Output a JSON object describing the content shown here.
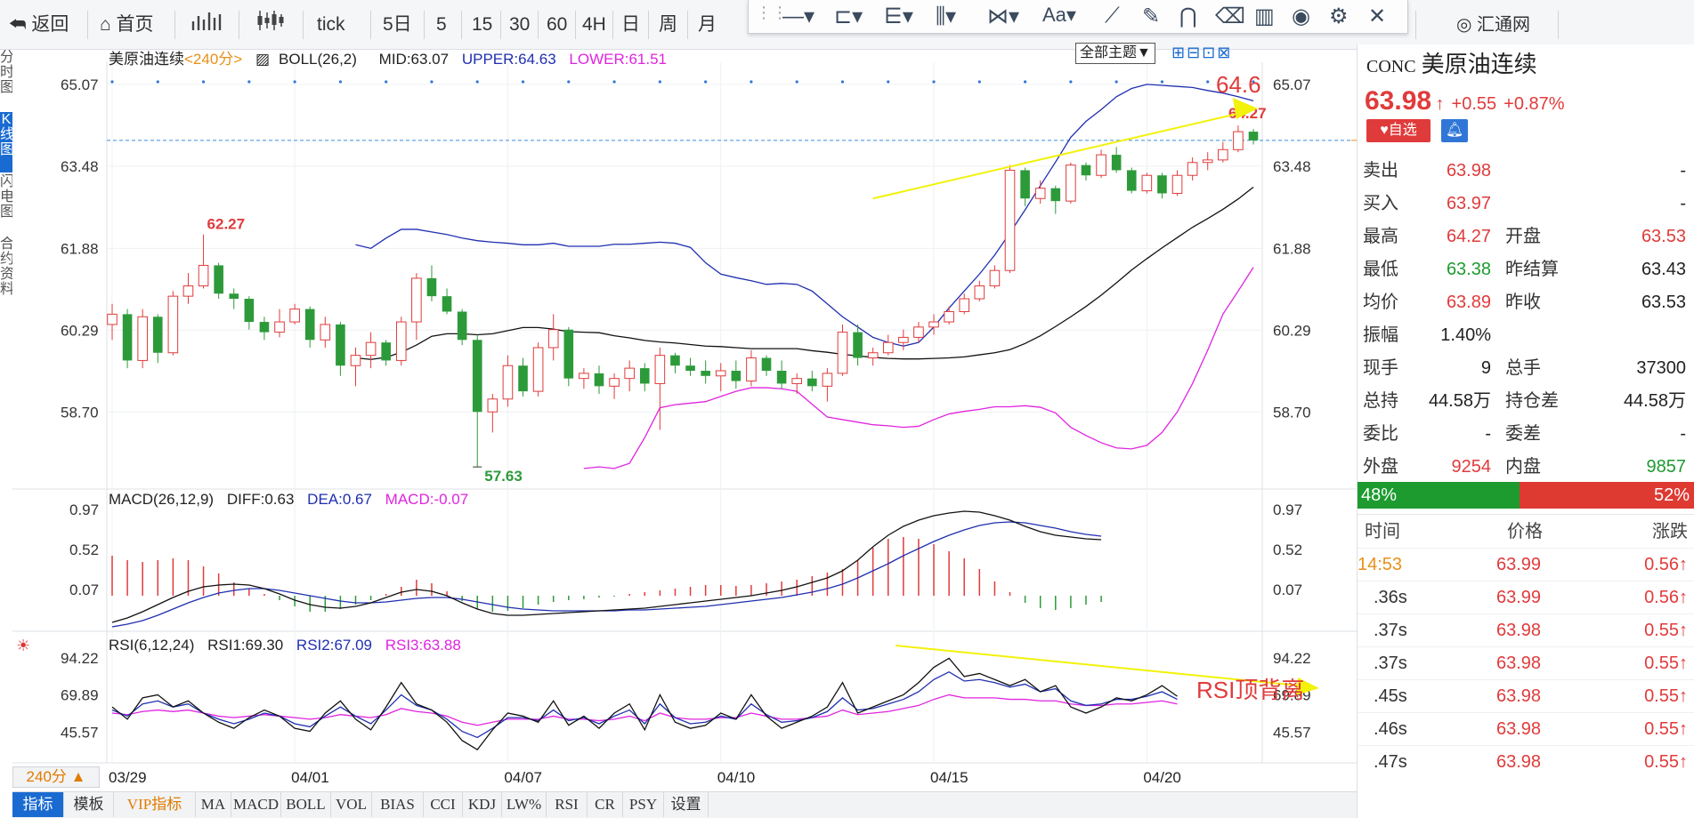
{
  "toolbar": {
    "back": "返回",
    "home": "首页",
    "tick": "tick",
    "five_day": "5日",
    "p5": "5",
    "p15": "15",
    "p30": "30",
    "p60": "60",
    "p4h": "4H",
    "day": "日",
    "week": "周",
    "month": "月",
    "brand": "汇通网"
  },
  "left_tabs": [
    "分时图",
    "K线图",
    "闪电图",
    "合约资料"
  ],
  "main_legend": {
    "name": "美原油连续",
    "period": "<240分>",
    "boll": "BOLL(26,2)",
    "mid": "MID:63.07",
    "upper": "UPPER:64.63",
    "lower": "LOWER:61.51"
  },
  "theme_button": "全部主题▼",
  "macd_legend": {
    "name": "MACD(26,12,9)",
    "diff": "DIFF:0.63",
    "dea": "DEA:0.67",
    "macd": "MACD:-0.07"
  },
  "rsi_legend": {
    "name": "RSI(6,12,24)",
    "rsi1": "RSI1:69.30",
    "rsi2": "RSI2:67.09",
    "rsi3": "RSI3:63.88"
  },
  "annotations": {
    "high_label": "62.27",
    "low_label": "57.63",
    "last_high": "64.27",
    "arrow_target": "64.6",
    "rsi_divergence": "RSI顶背离"
  },
  "period_button": "240分 ▲",
  "bottom_tabs": [
    "指标",
    "模板",
    "VIP指标",
    "MA",
    "MACD",
    "BOLL",
    "VOL",
    "BIAS",
    "CCI",
    "KDJ",
    "LW%",
    "RSI",
    "CR",
    "PSY",
    "设置"
  ],
  "quote": {
    "code": "CONC",
    "name": "美原油连续",
    "price": "63.98",
    "change": "+0.55",
    "change_pct": "+0.87%",
    "fav": "自选",
    "rows": [
      {
        "l1": "卖出",
        "v1": "63.98",
        "l2": "",
        "v2": "-",
        "c1": "red",
        "c2": "black"
      },
      {
        "l1": "买入",
        "v1": "63.97",
        "l2": "",
        "v2": "-",
        "c1": "red",
        "c2": "black"
      },
      {
        "l1": "最高",
        "v1": "64.27",
        "l2": "开盘",
        "v2": "63.53",
        "c1": "red",
        "c2": "red"
      },
      {
        "l1": "最低",
        "v1": "63.38",
        "l2": "昨结算",
        "v2": "63.43",
        "c1": "green",
        "c2": "black"
      },
      {
        "l1": "均价",
        "v1": "63.89",
        "l2": "昨收",
        "v2": "63.53",
        "c1": "red",
        "c2": "black"
      },
      {
        "l1": "振幅",
        "v1": "1.40%",
        "l2": "",
        "v2": "",
        "c1": "black",
        "c2": "black"
      },
      {
        "l1": "现手",
        "v1": "9",
        "l2": "总手",
        "v2": "37300",
        "c1": "black",
        "c2": "black"
      },
      {
        "l1": "总持",
        "v1": "44.58万",
        "l2": "持仓差",
        "v2": "44.58万",
        "c1": "black",
        "c2": "black"
      },
      {
        "l1": "委比",
        "v1": "-",
        "l2": "委差",
        "v2": "-",
        "c1": "black",
        "c2": "black"
      },
      {
        "l1": "外盘",
        "v1": "9254",
        "l2": "内盘",
        "v2": "9857",
        "c1": "red",
        "c2": "green"
      }
    ],
    "ratio_green": "48%",
    "ratio_red": "52%",
    "ratio_green_value": 0.48,
    "tick_header": {
      "time": "时间",
      "price": "价格",
      "change": "涨跌"
    },
    "ticks": [
      {
        "time": "14:53",
        "price": "63.99",
        "change": "0.56"
      },
      {
        "time": ".36s",
        "price": "63.99",
        "change": "0.56"
      },
      {
        "time": ".37s",
        "price": "63.98",
        "change": "0.55"
      },
      {
        "time": ".37s",
        "price": "63.98",
        "change": "0.55"
      },
      {
        "time": ".45s",
        "price": "63.98",
        "change": "0.55"
      },
      {
        "time": ".46s",
        "price": "63.98",
        "change": "0.55"
      },
      {
        "time": ".47s",
        "price": "63.98",
        "change": "0.55"
      }
    ]
  },
  "colors": {
    "up": "#e03b3b",
    "down": "#2d9a3a",
    "upper_band": "#1f2fb0",
    "mid_band": "#111111",
    "lower_band": "#e024e0",
    "annotation": "#f2f20a",
    "accent": "#1a6bd1"
  },
  "chart_data": {
    "type": "candlestick",
    "main_axis_ticks": [
      "65.07",
      "63.48",
      "61.88",
      "60.29",
      "58.70"
    ],
    "main_axis_values": [
      65.07,
      63.48,
      61.88,
      60.29,
      58.7
    ],
    "macd_axis_ticks": [
      "0.97",
      "0.52",
      "0.07"
    ],
    "macd_axis_values": [
      0.97,
      0.52,
      0.07
    ],
    "rsi_axis_ticks": [
      "94.22",
      "69.89",
      "45.57"
    ],
    "rsi_axis_values": [
      94.22,
      69.89,
      45.57
    ],
    "x_labels": [
      "03/29",
      "04/01",
      "04/07",
      "04/10",
      "04/15",
      "04/20"
    ],
    "x_label_index": [
      0,
      12,
      26,
      40,
      54,
      68
    ],
    "candles": [
      [
        60.4,
        60.8,
        60.1,
        60.6
      ],
      [
        60.6,
        60.7,
        59.55,
        59.7
      ],
      [
        59.7,
        60.7,
        59.55,
        60.55
      ],
      [
        60.55,
        60.6,
        59.65,
        59.85
      ],
      [
        59.85,
        61.05,
        59.8,
        60.95
      ],
      [
        60.95,
        61.4,
        60.8,
        61.15
      ],
      [
        61.15,
        62.15,
        61.1,
        61.55
      ],
      [
        61.55,
        61.6,
        60.9,
        61.0
      ],
      [
        61.0,
        61.1,
        60.7,
        60.9
      ],
      [
        60.9,
        60.95,
        60.3,
        60.45
      ],
      [
        60.45,
        60.55,
        60.1,
        60.25
      ],
      [
        60.25,
        60.7,
        60.15,
        60.45
      ],
      [
        60.45,
        60.8,
        60.4,
        60.7
      ],
      [
        60.7,
        60.75,
        59.95,
        60.1
      ],
      [
        60.1,
        60.55,
        59.95,
        60.4
      ],
      [
        60.4,
        60.45,
        59.4,
        59.6
      ],
      [
        59.6,
        59.95,
        59.2,
        59.8
      ],
      [
        59.8,
        60.25,
        59.55,
        60.05
      ],
      [
        60.05,
        60.1,
        59.6,
        59.7
      ],
      [
        59.7,
        60.55,
        59.6,
        60.45
      ],
      [
        60.45,
        61.4,
        60.1,
        61.3
      ],
      [
        61.3,
        61.55,
        60.85,
        60.95
      ],
      [
        60.95,
        61.1,
        60.6,
        60.65
      ],
      [
        60.65,
        60.7,
        60.0,
        60.1
      ],
      [
        60.1,
        60.2,
        57.63,
        58.7
      ],
      [
        58.7,
        59.05,
        58.3,
        58.95
      ],
      [
        58.95,
        59.8,
        58.8,
        59.6
      ],
      [
        59.6,
        59.75,
        59.0,
        59.1
      ],
      [
        59.1,
        60.05,
        59.0,
        59.95
      ],
      [
        59.95,
        60.6,
        59.7,
        60.3
      ],
      [
        60.3,
        60.35,
        59.2,
        59.35
      ],
      [
        59.35,
        59.55,
        59.15,
        59.45
      ],
      [
        59.45,
        59.6,
        59.05,
        59.2
      ],
      [
        59.2,
        59.45,
        58.95,
        59.35
      ],
      [
        59.35,
        59.7,
        59.1,
        59.55
      ],
      [
        59.55,
        59.65,
        59.1,
        59.25
      ],
      [
        59.25,
        59.95,
        58.35,
        59.8
      ],
      [
        59.8,
        59.85,
        59.45,
        59.6
      ],
      [
        59.6,
        59.75,
        59.4,
        59.5
      ],
      [
        59.5,
        59.7,
        59.25,
        59.4
      ],
      [
        59.4,
        59.65,
        59.1,
        59.5
      ],
      [
        59.5,
        59.7,
        59.15,
        59.3
      ],
      [
        59.3,
        59.9,
        59.2,
        59.75
      ],
      [
        59.75,
        59.8,
        59.4,
        59.5
      ],
      [
        59.5,
        59.7,
        59.15,
        59.25
      ],
      [
        59.25,
        59.45,
        59.05,
        59.35
      ],
      [
        59.35,
        59.5,
        59.1,
        59.2
      ],
      [
        59.2,
        59.55,
        58.9,
        59.45
      ],
      [
        59.45,
        60.4,
        59.4,
        60.25
      ],
      [
        60.25,
        60.4,
        59.6,
        59.75
      ],
      [
        59.75,
        59.95,
        59.6,
        59.85
      ],
      [
        59.85,
        60.2,
        59.8,
        60.05
      ],
      [
        60.05,
        60.3,
        59.9,
        60.15
      ],
      [
        60.15,
        60.45,
        60.05,
        60.35
      ],
      [
        60.35,
        60.6,
        60.2,
        60.45
      ],
      [
        60.45,
        60.75,
        60.4,
        60.65
      ],
      [
        60.65,
        61.0,
        60.6,
        60.9
      ],
      [
        60.9,
        61.25,
        60.85,
        61.15
      ],
      [
        61.15,
        61.55,
        61.1,
        61.45
      ],
      [
        61.45,
        63.5,
        61.4,
        63.4
      ],
      [
        63.4,
        63.45,
        62.7,
        62.85
      ],
      [
        62.85,
        63.2,
        62.75,
        63.05
      ],
      [
        63.05,
        63.1,
        62.55,
        62.8
      ],
      [
        62.8,
        63.55,
        62.75,
        63.5
      ],
      [
        63.5,
        63.55,
        63.2,
        63.3
      ],
      [
        63.3,
        63.8,
        63.25,
        63.7
      ],
      [
        63.7,
        63.85,
        63.35,
        63.4
      ],
      [
        63.4,
        63.45,
        62.95,
        63.0
      ],
      [
        63.0,
        63.35,
        62.95,
        63.3
      ],
      [
        63.3,
        63.35,
        62.85,
        62.95
      ],
      [
        62.95,
        63.4,
        62.9,
        63.3
      ],
      [
        63.3,
        63.65,
        63.2,
        63.55
      ],
      [
        63.55,
        63.75,
        63.4,
        63.6
      ],
      [
        63.6,
        63.95,
        63.55,
        63.8
      ],
      [
        63.8,
        64.27,
        63.75,
        64.15
      ],
      [
        64.15,
        64.2,
        63.9,
        63.98
      ]
    ],
    "upper": [
      61.95,
      61.88,
      62.08,
      62.25,
      62.25,
      62.2,
      62.15,
      62.08,
      62.03,
      62.0,
      61.98,
      61.95,
      61.95,
      61.98,
      61.92,
      61.92,
      61.92,
      61.96,
      61.96,
      61.98,
      62.0,
      61.98,
      61.9,
      61.6,
      61.38,
      61.31,
      61.25,
      61.18,
      61.2,
      61.18,
      61.05,
      60.8,
      60.55,
      60.35,
      60.15,
      60.05,
      59.98,
      60.05,
      60.35,
      60.72,
      61.05,
      61.38,
      61.75,
      62.18,
      62.63,
      63.1,
      63.56,
      64.04,
      64.35,
      64.58,
      64.83,
      64.99,
      65.07,
      65.05,
      65.03,
      65.01,
      64.95,
      64.9,
      64.83,
      64.75
    ],
    "mid": [
      59.75,
      59.72,
      59.76,
      59.86,
      60.0,
      60.17,
      60.22,
      60.22,
      60.2,
      60.22,
      60.28,
      60.34,
      60.34,
      60.31,
      60.26,
      60.25,
      60.24,
      60.18,
      60.14,
      60.09,
      60.06,
      60.04,
      60.01,
      59.98,
      59.97,
      59.95,
      59.93,
      59.93,
      59.93,
      59.93,
      59.89,
      59.86,
      59.82,
      59.79,
      59.76,
      59.74,
      59.73,
      59.73,
      59.74,
      59.75,
      59.77,
      59.81,
      59.85,
      59.91,
      60.03,
      60.18,
      60.36,
      60.55,
      60.75,
      60.97,
      61.21,
      61.46,
      61.68,
      61.89,
      62.09,
      62.29,
      62.46,
      62.64,
      62.84,
      63.07
    ],
    "lower": [
      57.6,
      57.63,
      57.6,
      57.7,
      58.2,
      58.78,
      58.84,
      58.87,
      58.9,
      59.0,
      59.1,
      59.17,
      59.17,
      59.15,
      59.1,
      58.85,
      58.6,
      58.55,
      58.5,
      58.45,
      58.43,
      58.4,
      58.42,
      58.55,
      58.66,
      58.71,
      58.75,
      58.8,
      58.8,
      58.82,
      58.79,
      58.68,
      58.4,
      58.24,
      58.1,
      58.0,
      57.98,
      58.05,
      58.3,
      58.7,
      59.25,
      59.9,
      60.6,
      61.05,
      61.51
    ],
    "macd_diff": [
      -0.3,
      -0.25,
      -0.18,
      -0.1,
      -0.02,
      0.05,
      0.1,
      0.12,
      0.13,
      0.12,
      0.08,
      0.02,
      -0.05,
      -0.1,
      -0.13,
      -0.14,
      -0.12,
      -0.08,
      -0.02,
      0.04,
      0.07,
      0.05,
      0.0,
      -0.08,
      -0.15,
      -0.2,
      -0.22,
      -0.22,
      -0.21,
      -0.2,
      -0.19,
      -0.18,
      -0.17,
      -0.16,
      -0.15,
      -0.14,
      -0.12,
      -0.1,
      -0.08,
      -0.06,
      -0.04,
      -0.02,
      0.0,
      0.03,
      0.06,
      0.1,
      0.15,
      0.2,
      0.28,
      0.4,
      0.55,
      0.68,
      0.78,
      0.85,
      0.9,
      0.93,
      0.95,
      0.94,
      0.9,
      0.85,
      0.78,
      0.72,
      0.68,
      0.66,
      0.64,
      0.63
    ],
    "macd_dea": [
      -0.35,
      -0.32,
      -0.28,
      -0.22,
      -0.15,
      -0.08,
      -0.02,
      0.03,
      0.06,
      0.08,
      0.08,
      0.06,
      0.03,
      0.0,
      -0.03,
      -0.06,
      -0.08,
      -0.08,
      -0.07,
      -0.05,
      -0.03,
      -0.02,
      -0.02,
      -0.04,
      -0.07,
      -0.1,
      -0.13,
      -0.15,
      -0.16,
      -0.17,
      -0.17,
      -0.17,
      -0.17,
      -0.17,
      -0.16,
      -0.16,
      -0.15,
      -0.14,
      -0.13,
      -0.12,
      -0.1,
      -0.08,
      -0.06,
      -0.04,
      -0.02,
      0.01,
      0.04,
      0.08,
      0.13,
      0.2,
      0.28,
      0.36,
      0.45,
      0.53,
      0.61,
      0.68,
      0.74,
      0.79,
      0.82,
      0.83,
      0.82,
      0.79,
      0.76,
      0.72,
      0.69,
      0.67
    ],
    "macd_hist": [
      0.45,
      0.4,
      0.38,
      0.4,
      0.42,
      0.4,
      0.33,
      0.25,
      0.15,
      0.08,
      0.02,
      -0.05,
      -0.12,
      -0.18,
      -0.18,
      -0.15,
      -0.1,
      -0.05,
      0.02,
      0.1,
      0.18,
      0.14,
      0.05,
      -0.06,
      -0.15,
      -0.18,
      -0.17,
      -0.14,
      -0.1,
      -0.07,
      -0.05,
      -0.04,
      -0.02,
      -0.01,
      0.02,
      0.04,
      0.06,
      0.08,
      0.1,
      0.12,
      0.12,
      0.11,
      0.12,
      0.14,
      0.16,
      0.18,
      0.22,
      0.26,
      0.3,
      0.4,
      0.54,
      0.64,
      0.66,
      0.64,
      0.58,
      0.5,
      0.42,
      0.3,
      0.16,
      0.04,
      -0.08,
      -0.14,
      -0.16,
      -0.14,
      -0.1,
      -0.07
    ],
    "rsi1": [
      62,
      54,
      68,
      70,
      62,
      66,
      58,
      52,
      48,
      55,
      60,
      56,
      48,
      46,
      58,
      66,
      54,
      47,
      62,
      78,
      64,
      60,
      52,
      40,
      34,
      47,
      58,
      56,
      52,
      66,
      50,
      56,
      48,
      58,
      64,
      47,
      70,
      52,
      48,
      50,
      58,
      54,
      70,
      56,
      48,
      52,
      56,
      62,
      78,
      58,
      62,
      66,
      70,
      78,
      88,
      94,
      82,
      84,
      80,
      76,
      80,
      72,
      76,
      62,
      58,
      62,
      68,
      66,
      70,
      76,
      69
    ],
    "rsi2": [
      60,
      56,
      64,
      66,
      62,
      64,
      58,
      54,
      51,
      54,
      58,
      56,
      51,
      49,
      56,
      62,
      56,
      51,
      60,
      70,
      63,
      60,
      54,
      46,
      42,
      48,
      55,
      55,
      53,
      60,
      53,
      55,
      51,
      56,
      60,
      51,
      64,
      55,
      51,
      52,
      56,
      54,
      64,
      57,
      52,
      53,
      55,
      59,
      68,
      60,
      61,
      64,
      67,
      72,
      80,
      85,
      79,
      80,
      78,
      75,
      77,
      72,
      74,
      66,
      63,
      64,
      67,
      67,
      69,
      72,
      67
    ],
    "rsi3": [
      58,
      57,
      59,
      60,
      59,
      60,
      58,
      56,
      55,
      56,
      57,
      56,
      55,
      54,
      55,
      57,
      56,
      55,
      57,
      61,
      59,
      58,
      56,
      52,
      50,
      52,
      54,
      54,
      54,
      56,
      54,
      54,
      53,
      54,
      56,
      53,
      58,
      55,
      54,
      54,
      55,
      55,
      58,
      56,
      54,
      54,
      55,
      56,
      60,
      57,
      58,
      59,
      61,
      63,
      67,
      70,
      68,
      68,
      68,
      67,
      67,
      66,
      66,
      64,
      63,
      63,
      64,
      64,
      65,
      66,
      64
    ]
  }
}
